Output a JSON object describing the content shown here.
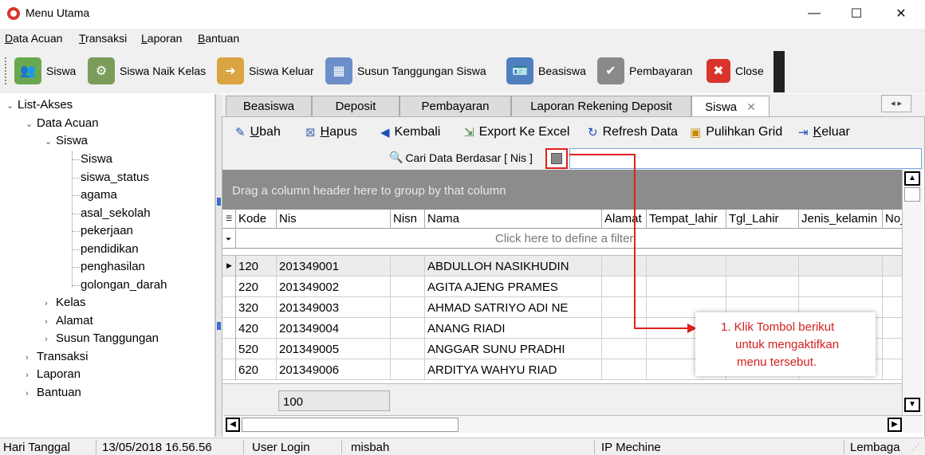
{
  "window": {
    "title": "Menu Utama",
    "minimize": "—",
    "maximize": "☐",
    "close": "✕"
  },
  "menubar": [
    "Data Acuan",
    "Transaksi",
    "Laporan",
    "Bantuan"
  ],
  "toolbar": {
    "items": [
      {
        "label": "Siswa",
        "icon": "students-icon"
      },
      {
        "label": "Siswa Naik Kelas",
        "icon": "students-gear-icon"
      },
      {
        "label": "Siswa Keluar",
        "icon": "student-exit-icon"
      },
      {
        "label": "Susun Tanggungan Siswa",
        "icon": "grid-student-icon"
      },
      {
        "label": "Beasiswa",
        "icon": "id-card-icon"
      },
      {
        "label": "Pembayaran",
        "icon": "clipboard-check-icon"
      },
      {
        "label": "Close",
        "icon": "close-x-icon"
      }
    ]
  },
  "tree": {
    "root": "List-Akses",
    "data_acuan": "Data Acuan",
    "siswa": "Siswa",
    "siswa_children": [
      "Siswa",
      "siswa_status",
      "agama",
      "asal_sekolah",
      "pekerjaan",
      "pendidikan",
      "penghasilan",
      "golongan_darah"
    ],
    "kelas": "Kelas",
    "alamat": "Alamat",
    "susun": "Susun Tanggungan",
    "transaksi": "Transaksi",
    "laporan": "Laporan",
    "bantuan": "Bantuan"
  },
  "tabs": [
    "Beasiswa",
    "Deposit",
    "Pembayaran",
    "Laporan Rekening Deposit",
    "Siswa"
  ],
  "tab_close": "✕",
  "actions": [
    {
      "label": "Ubah",
      "icon": "pencil-icon"
    },
    {
      "label": "Hapus",
      "icon": "delete-icon"
    },
    {
      "label": "Kembali",
      "icon": "back-arrow-icon"
    },
    {
      "label": "Export Ke Excel",
      "icon": "export-icon"
    },
    {
      "label": "Refresh Data",
      "icon": "refresh-icon"
    },
    {
      "label": "Pulihkan Grid",
      "icon": "restore-grid-icon"
    },
    {
      "label": "Keluar",
      "icon": "exit-icon"
    }
  ],
  "search": {
    "label": "Cari Data Berdasar [ Nis ]",
    "value": ""
  },
  "grid": {
    "group_hint": "Drag a column header here to group by that column",
    "filter_hint": "Click here to define a filter",
    "columns": [
      "Kode",
      "Nis",
      "Nisn",
      "Nama",
      "Alamat",
      "Tempat_lahir",
      "Tgl_Lahir",
      "Jenis_kelamin",
      "No_"
    ],
    "rows": [
      {
        "kode": "120",
        "nis": "201349001",
        "nama": "ABDULLOH  NASIKHUDIN"
      },
      {
        "kode": "220",
        "nis": "201349002",
        "nama": "AGITA  AJENG  PRAMES"
      },
      {
        "kode": "320",
        "nis": "201349003",
        "nama": "AHMAD SATRIYO ADI NE"
      },
      {
        "kode": "420",
        "nis": "201349004",
        "nama": "ANANG  RIADI"
      },
      {
        "kode": "520",
        "nis": "201349005",
        "nama": "ANGGAR  SUNU  PRADHI"
      },
      {
        "kode": "620",
        "nis": "201349006",
        "nama": "ARDITYA  WAHYU  RIAD"
      }
    ],
    "footer_count": "100"
  },
  "annotation": {
    "lines": [
      "1. Klik Tombol berikut",
      "untuk mengaktifkan",
      "menu tersebut."
    ]
  },
  "statusbar": {
    "date_label": "Hari Tanggal",
    "date_value": "13/05/2018 16.56.56",
    "user_label": "User Login",
    "user_value": "misbah",
    "ip_label": "IP Mechine",
    "lembaga_label": "Lembaga"
  },
  "colors": {
    "accent_red": "#e0201c",
    "group_panel": "#8c8c8c"
  }
}
